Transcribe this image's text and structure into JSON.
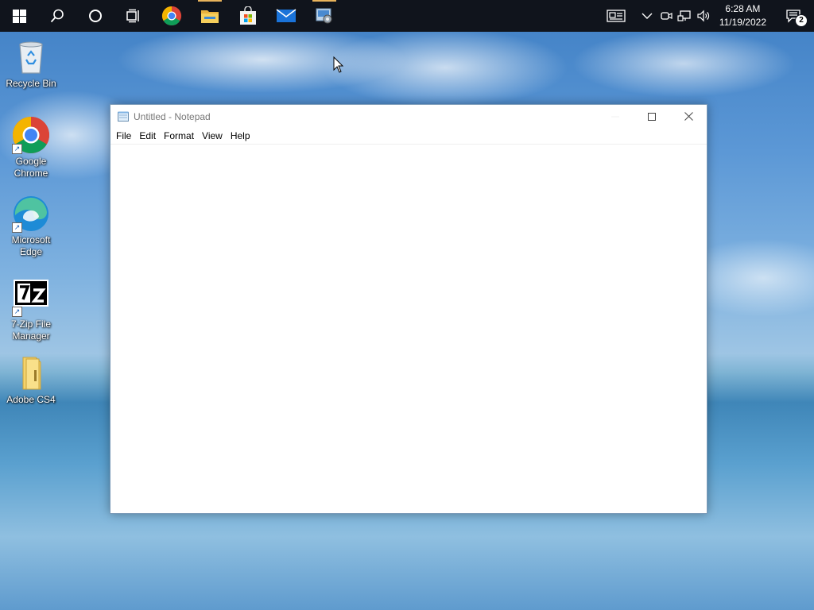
{
  "taskbar": {
    "items": [
      {
        "name": "start",
        "label": "Start"
      },
      {
        "name": "search",
        "label": "Search"
      },
      {
        "name": "cortana",
        "label": "Cortana"
      },
      {
        "name": "task-view",
        "label": "Task View"
      },
      {
        "name": "chrome",
        "label": "Google Chrome"
      },
      {
        "name": "file-explorer",
        "label": "File Explorer"
      },
      {
        "name": "store",
        "label": "Microsoft Store"
      },
      {
        "name": "mail",
        "label": "Mail"
      },
      {
        "name": "control-panel",
        "label": "Control Panel"
      }
    ],
    "clock": {
      "time": "6:28 AM",
      "date": "11/19/2022"
    },
    "notification_count": "2"
  },
  "desktop": {
    "icons": [
      {
        "label": "Recycle Bin"
      },
      {
        "label": "Google Chrome"
      },
      {
        "label": "Microsoft Edge"
      },
      {
        "label": "7-Zip File Manager"
      },
      {
        "label": "Adobe CS4"
      }
    ]
  },
  "notepad": {
    "title": "Untitled - Notepad",
    "menu": [
      "File",
      "Edit",
      "Format",
      "View",
      "Help"
    ],
    "content": ""
  },
  "colors": {
    "taskbar": "#10141c",
    "running_indicator": "#e8b35b"
  }
}
